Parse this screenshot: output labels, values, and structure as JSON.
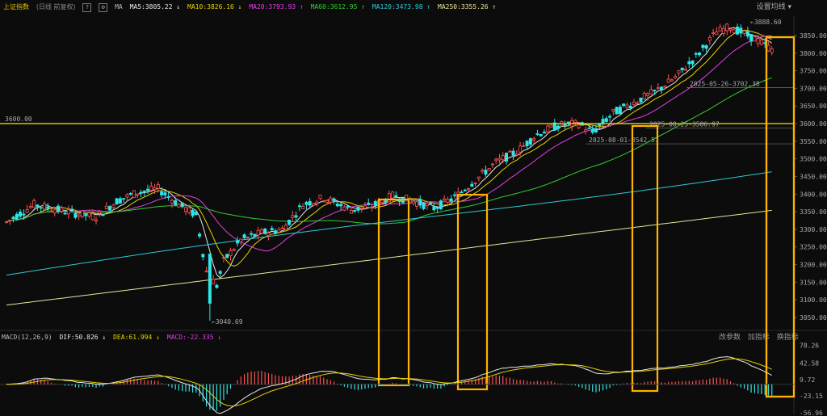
{
  "header": {
    "title": "上证指数",
    "mode": "(日线 前复权)",
    "ma_label": "MA",
    "items": [
      {
        "text": "MA5:3805.22",
        "arrow": "↓",
        "color": "#e8e8e8"
      },
      {
        "text": "MA10:3826.16",
        "arrow": "↓",
        "color": "#e6d200"
      },
      {
        "text": "MA20:3793.93",
        "arrow": "↑",
        "color": "#e040e0"
      },
      {
        "text": "MA60:3612.95",
        "arrow": "↑",
        "color": "#33cc33"
      },
      {
        "text": "MA120:3473.98",
        "arrow": "↑",
        "color": "#2ec8d8"
      },
      {
        "text": "MA250:3355.26",
        "arrow": "↑",
        "color": "#e8e49a"
      }
    ],
    "settings_label": "设置均线"
  },
  "macd": {
    "label": "MACD(12,26,9)",
    "dif": "DIF:50.826",
    "dea": "DEA:61.994",
    "macd": "MACD:-22.335",
    "dif_arrow": "↓",
    "dea_arrow": "↓",
    "macd_arrow": "↓",
    "tools": [
      "改参数",
      "加指标",
      "换指标"
    ]
  },
  "chart_data": {
    "type": "candlestick",
    "price_axis": {
      "ticks": [
        "3850.00",
        "3800.00",
        "3750.00",
        "3700.00",
        "3650.00",
        "3600.00",
        "3550.00",
        "3500.00",
        "3450.00",
        "3400.00",
        "3350.00",
        "3300.00",
        "3250.00",
        "3200.00",
        "3150.00",
        "3100.00",
        "3050.00"
      ],
      "ylim": [
        3020,
        3905
      ]
    },
    "macd_axis": {
      "ticks": [
        "78.26",
        "42.58",
        "9.72",
        "-23.15",
        "-56.96"
      ],
      "ylim": [
        -60,
        90
      ]
    },
    "reference_line": {
      "label": "3600.00",
      "value": 3600
    },
    "annotations": [
      {
        "text": "3888.60",
        "value": 3888.6,
        "position": "high"
      },
      {
        "text": "3040.69",
        "value": 3040.69,
        "position": "low"
      },
      {
        "text": "2025-05-26-3702.38",
        "value": 3702.38
      },
      {
        "text": "2025-08-25-3586.97",
        "value": 3586.97
      },
      {
        "text": "2025-08-01-3542.57",
        "value": 3542.57
      }
    ],
    "highlight_boxes": 5,
    "candle_count": 166,
    "colors": {
      "up": "#ff5050",
      "down": "#2fe6e6",
      "ref": "#ffe600",
      "box": "#ffb300"
    }
  }
}
